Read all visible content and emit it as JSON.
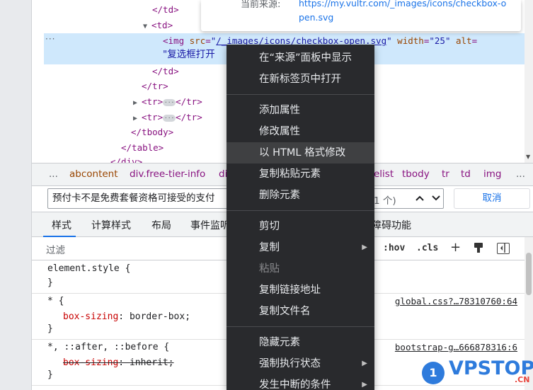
{
  "dom_tree": {
    "lines": [
      {
        "close_td_1": "</td>"
      },
      {
        "open_td": "<td>"
      },
      {
        "img_tag_open": "<img",
        "src_attr": "src",
        "src_val": "/_images/icons/checkbox-open.svg",
        "width_attr": "width",
        "width_val": "25",
        "alt_attr": "alt",
        "alt_val_part": "\"复选框打开"
      },
      {
        "close_td_2": "</td>"
      },
      {
        "close_tr": "</tr>"
      },
      {
        "tr_collapsed_1_open": "<tr>",
        "tr_collapsed_1_close": "</tr>"
      },
      {
        "tr_collapsed_2_open": "<tr>",
        "tr_collapsed_2_close": "</tr>"
      },
      {
        "close_tbody": "</tbody>"
      },
      {
        "close_table": "</table>"
      },
      {
        "close_div": "</div>"
      }
    ],
    "row_dots": "···",
    "ellipsis": "···"
  },
  "source_tooltip": {
    "label": "当前来源:",
    "url": "https://my.vultr.com/_images/icons/checkbox-open.svg"
  },
  "breadcrumb": {
    "more_left": "...",
    "items": [
      "abcontent",
      "div.free-tier-info",
      "di",
      "elist",
      "tbody",
      "tr",
      "td",
      "img"
    ],
    "more_right": "..."
  },
  "search": {
    "value": "预付卡不是免费套餐资格可接受的支付",
    "count": "1 个)",
    "cancel_label": "取消"
  },
  "styles_tabs": [
    "样式",
    "计算样式",
    "布局",
    "事件监听",
    "障碍功能"
  ],
  "filter": {
    "placeholder": "过滤",
    "hov": ":hov",
    "cls": ".cls",
    "plus": "+"
  },
  "rules": [
    {
      "selector": "element.style {",
      "close": "}"
    },
    {
      "selector": "* {",
      "prop": "box-sizing",
      "value": "border-box;",
      "source": "global.css?…78310760:64",
      "close": "}"
    },
    {
      "selector": "*, ::after, ::before {",
      "prop": "box-sizing",
      "value": "inherit;",
      "source": "bootstrap-g…666878316:6",
      "close": "}"
    }
  ],
  "context_menu": {
    "groups": [
      [
        "在“来源”面板中显示",
        "在新标签页中打开"
      ],
      [
        "添加属性",
        "修改属性",
        "以 HTML 格式修改",
        "复制粘贴元素",
        "删除元素"
      ],
      [
        "剪切",
        "复制",
        "粘贴",
        "复制链接地址",
        "复制文件名"
      ],
      [
        "隐藏元素",
        "强制执行状态",
        "发生中断的条件"
      ]
    ],
    "highlighted": "以 HTML 格式修改",
    "disabled": "粘贴",
    "submenu_arrow": "▶"
  },
  "watermark": {
    "badge": "1",
    "text": "VPSTOP",
    "suffix": ".CN"
  },
  "icons": {
    "expand": "▶",
    "collapse": "▼",
    "up": "⌃",
    "down": "⌄"
  },
  "colors": {
    "selection_row": "#cfe8fc",
    "menu_bg": "#292a2d",
    "link_blue": "#1a73e8",
    "tag_purple": "#881280",
    "prop_red": "#c80000"
  }
}
